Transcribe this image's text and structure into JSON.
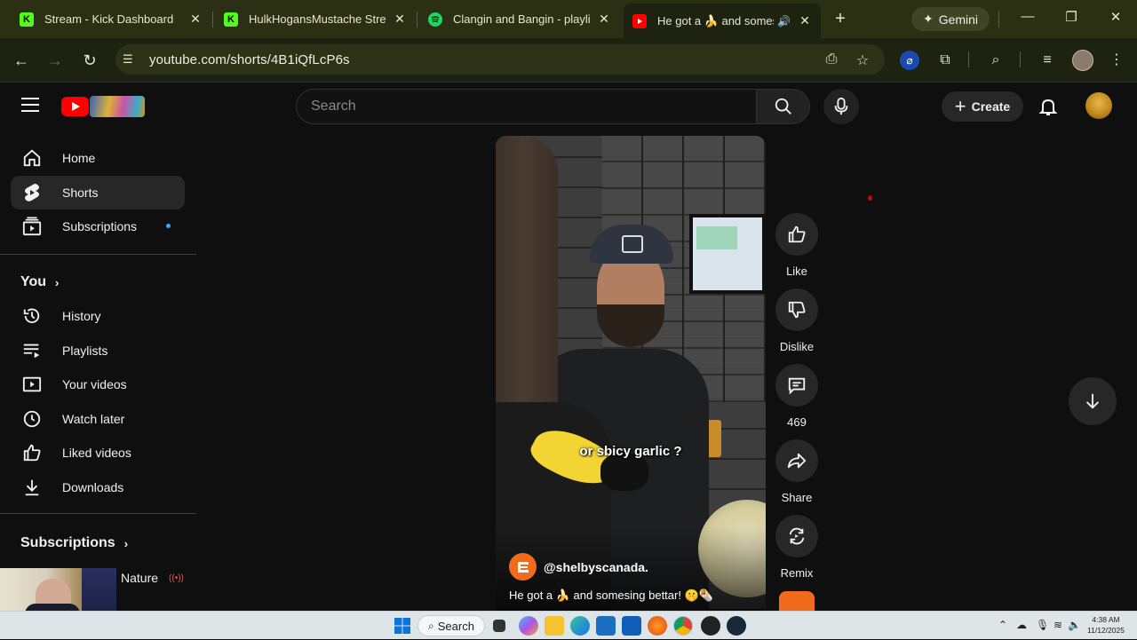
{
  "browser": {
    "tabs": [
      {
        "title": "Stream - Kick Dashboard",
        "icon": "kick-icon",
        "color": "#53fc18"
      },
      {
        "title": "HulkHogansMustache Stream",
        "icon": "kick-icon",
        "color": "#53fc18"
      },
      {
        "title": "Clangin and Bangin - playlist",
        "icon": "spotify-icon",
        "color": "#1ed760"
      },
      {
        "title": "He got a 🍌 and somesing bettar!",
        "icon": "youtube-icon",
        "color": "#ff0000",
        "active": true
      }
    ],
    "gemini_label": "Gemini",
    "url": "youtube.com/shorts/4B1iQfLcP6s"
  },
  "youtube": {
    "search_placeholder": "Search",
    "create_label": "Create",
    "sidebar": {
      "main": [
        {
          "label": "Home",
          "icon": "home-icon"
        },
        {
          "label": "Shorts",
          "icon": "shorts-icon",
          "active": true
        },
        {
          "label": "Subscriptions",
          "icon": "subscriptions-icon",
          "new": true
        }
      ],
      "you_heading": "You",
      "you": [
        {
          "label": "History",
          "icon": "history-icon"
        },
        {
          "label": "Playlists",
          "icon": "playlists-icon"
        },
        {
          "label": "Your videos",
          "icon": "your-videos-icon"
        },
        {
          "label": "Watch later",
          "icon": "watch-later-icon"
        },
        {
          "label": "Liked videos",
          "icon": "liked-videos-icon"
        },
        {
          "label": "Downloads",
          "icon": "downloads-icon"
        }
      ],
      "subscriptions_heading": "Subscriptions",
      "subscription_item": "Nature"
    },
    "short": {
      "caption": "or sbicy garlic ?",
      "channel": "@shelbyscanada.",
      "description": "He got a 🍌 and somesing bettar! 🤫🌯"
    },
    "actions": [
      {
        "label": "Like",
        "icon": "thumbs-up-icon"
      },
      {
        "label": "Dislike",
        "icon": "thumbs-down-icon"
      },
      {
        "label": "469",
        "icon": "comment-icon"
      },
      {
        "label": "Share",
        "icon": "share-icon"
      },
      {
        "label": "Remix",
        "icon": "remix-icon"
      }
    ]
  },
  "taskbar": {
    "search_label": "Search",
    "time": "4:38 AM",
    "date": "11/12/2025"
  }
}
